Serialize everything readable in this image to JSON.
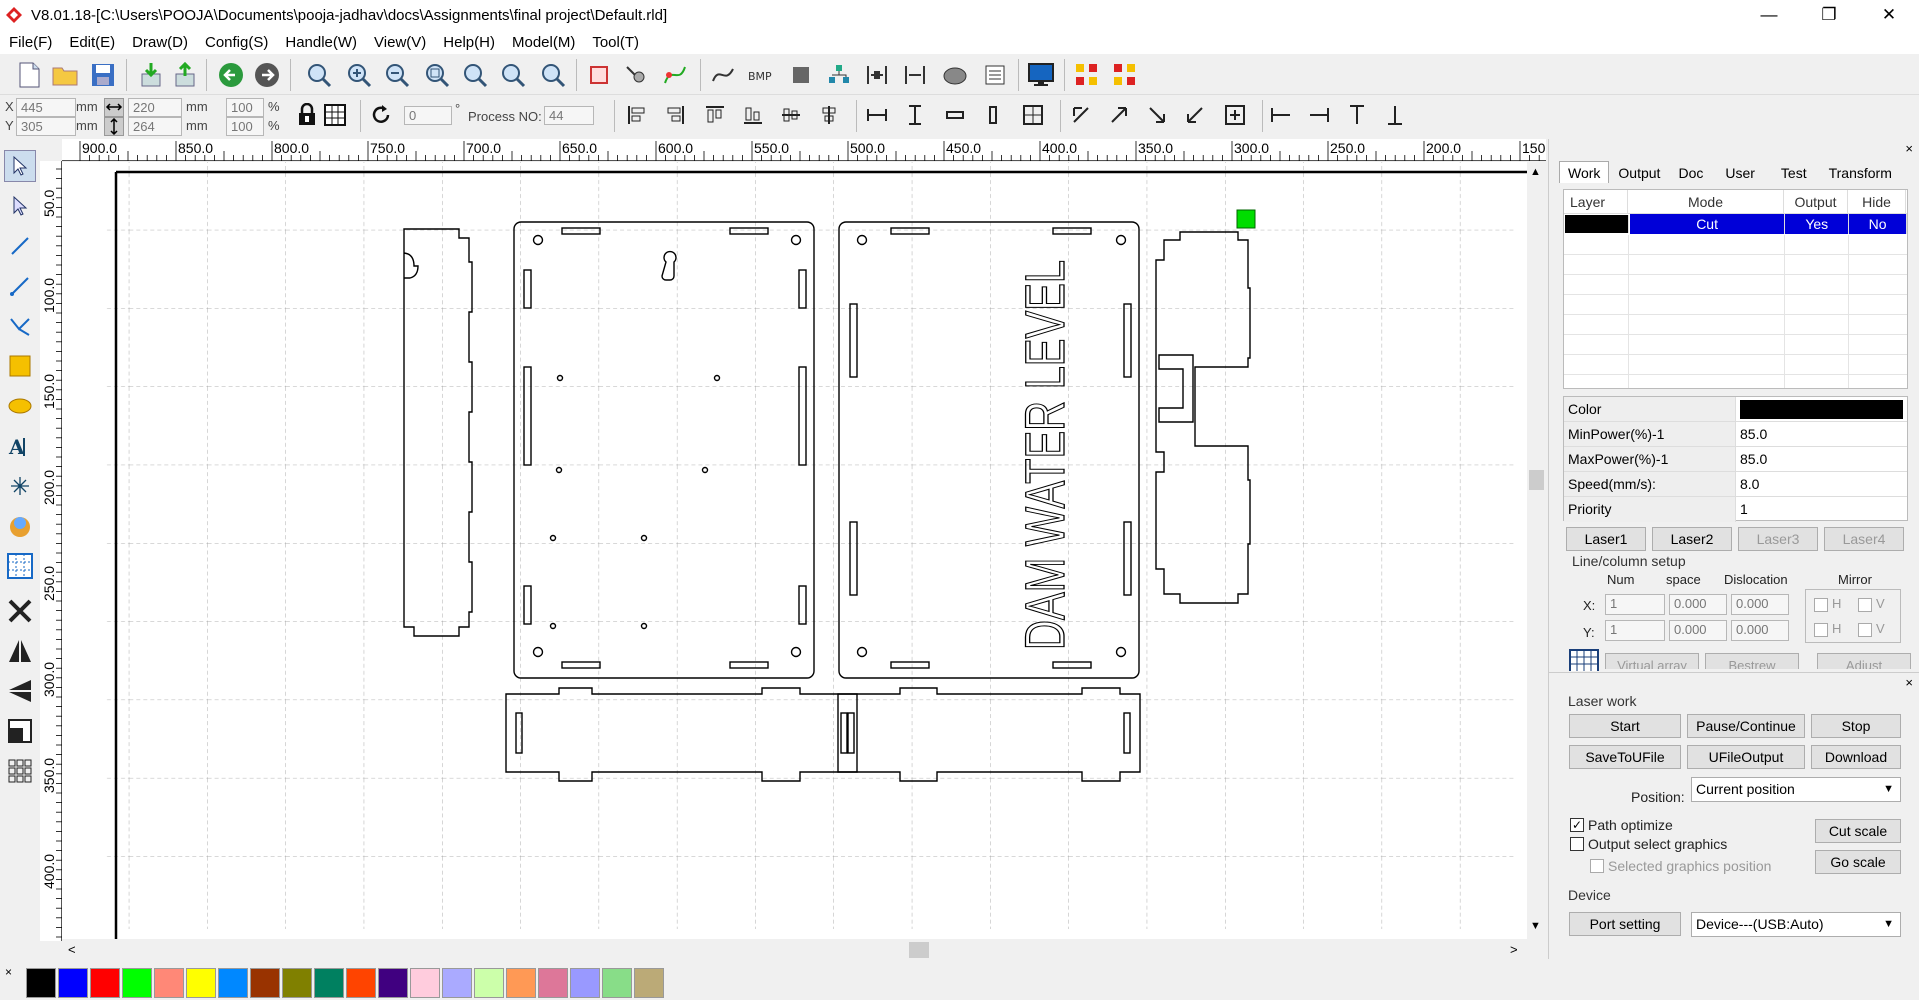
{
  "window": {
    "title": "V8.01.18-[C:\\Users\\POOJA\\Documents\\pooja-jadhav\\docs\\Assignments\\final project\\Default.rld]",
    "minimize": "—",
    "maximize": "❐",
    "close": "✕"
  },
  "menu": [
    "File(F)",
    "Edit(E)",
    "Draw(D)",
    "Config(S)",
    "Handle(W)",
    "View(V)",
    "Help(H)",
    "Model(M)",
    "Tool(T)"
  ],
  "toolbar2": {
    "x_label": "X",
    "y_label": "Y",
    "x_value": "445",
    "y_value": "305",
    "unit": "mm",
    "width_value": "220",
    "height_value": "264",
    "scale_w": "100",
    "scale_h": "100",
    "percent": "%",
    "angle": "0",
    "degree": "°",
    "process_no_label": "Process NO:",
    "process_no_value": "44"
  },
  "ruler": {
    "h_labels": [
      "900.0",
      "850.0",
      "800.0",
      "750.0",
      "700.0",
      "650.0",
      "600.0",
      "550.0",
      "500.0",
      "450.0",
      "400.0",
      "350.0",
      "300.0",
      "250.0",
      "200.0",
      "150.0"
    ],
    "v_labels": [
      "50.0",
      "100.0",
      "150.0",
      "200.0",
      "250.0",
      "300.0",
      "350.0",
      "400.0"
    ]
  },
  "canvas": {
    "engraved_text": "DAM WATER LEVEL",
    "marker_color": "#00dd00"
  },
  "panel": {
    "tabs": [
      "Work",
      "Output",
      "Doc",
      "User",
      "Test",
      "Transform"
    ],
    "active_tab": "Work",
    "layer_headers": [
      "Layer",
      "Mode",
      "Output",
      "Hide"
    ],
    "layer_row": {
      "color": "#000000",
      "mode": "Cut",
      "output": "Yes",
      "hide": "No"
    },
    "props": [
      {
        "k": "Color",
        "v": ""
      },
      {
        "k": "MinPower(%)-1",
        "v": "85.0"
      },
      {
        "k": "MaxPower(%)-1",
        "v": "85.0"
      },
      {
        "k": "Speed(mm/s):",
        "v": "8.0"
      },
      {
        "k": "Priority",
        "v": "1"
      }
    ],
    "lasers": [
      "Laser1",
      "Laser2",
      "Laser3",
      "Laser4"
    ],
    "line_column_setup": "Line/column setup",
    "lc_headers": [
      "Num",
      "space",
      "Dislocation",
      "Mirror"
    ],
    "x_label": "X:",
    "y_label": "Y:",
    "x_num": "1",
    "x_space": "0.000",
    "x_disloc": "0.000",
    "y_num": "1",
    "y_space": "0.000",
    "y_disloc": "0.000",
    "mirror_h": "H",
    "mirror_v": "V",
    "virtual_array": "Virtual array",
    "bestrew": "Bestrew",
    "adjust": "Adjust",
    "laser_work": "Laser work",
    "start": "Start",
    "pause": "Pause/Continue",
    "stop": "Stop",
    "save_ufile": "SaveToUFile",
    "ufile_output": "UFileOutput",
    "download": "Download",
    "position_label": "Position:",
    "position_value": "Current position",
    "path_optimize": "Path optimize",
    "output_select": "Output select graphics",
    "selected_pos": "Selected graphics position",
    "cut_scale": "Cut scale",
    "go_scale": "Go scale",
    "device": "Device",
    "port_setting": "Port setting",
    "device_value": "Device---(USB:Auto)"
  },
  "palette_colors": [
    "#000000",
    "#0000ff",
    "#ff0000",
    "#00ff00",
    "#ff8877",
    "#ffff00",
    "#0088ff",
    "#993300",
    "#808000",
    "#008060",
    "#ff4400",
    "#400080",
    "#ffccdd",
    "#aaaaff",
    "#ccffaa",
    "#ff9955",
    "#dd7799",
    "#9999ff",
    "#88dd88",
    "#bbaa77"
  ]
}
